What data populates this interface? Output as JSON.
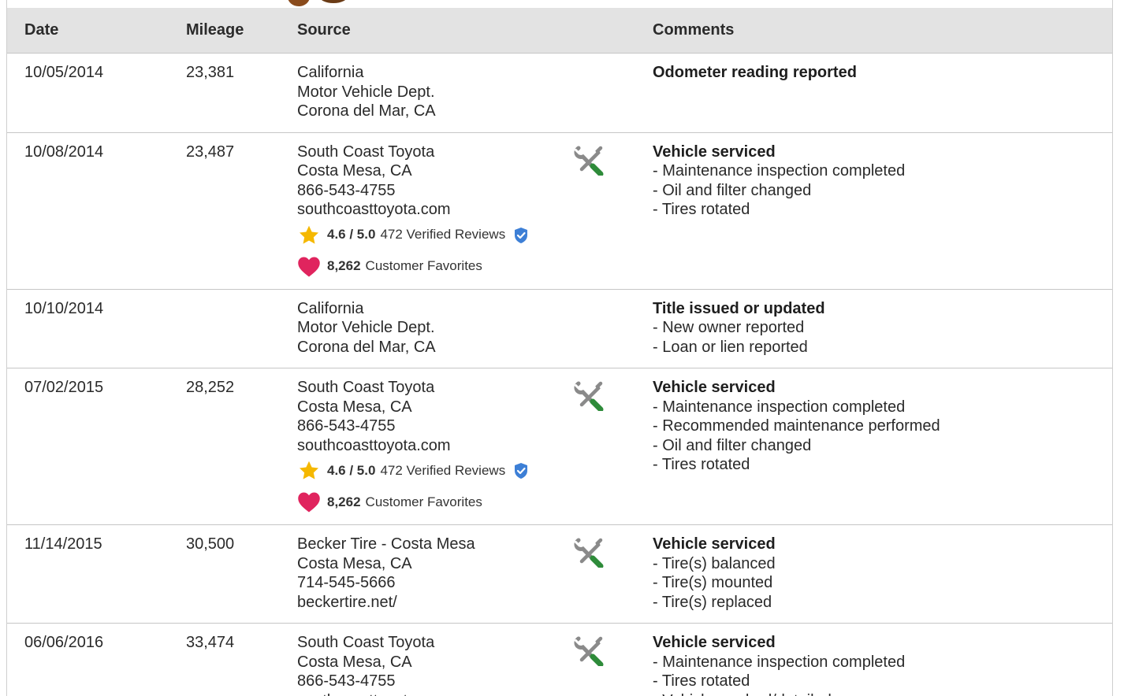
{
  "table": {
    "headers": {
      "date": "Date",
      "mileage": "Mileage",
      "source": "Source",
      "comments": "Comments"
    },
    "rows": [
      {
        "date": "10/05/2014",
        "mileage": "23,381",
        "source": [
          "California",
          "Motor Vehicle Dept.",
          "Corona del Mar, CA"
        ],
        "service_icon": false,
        "comment_title": "Odometer reading reported",
        "comment_items": []
      },
      {
        "date": "10/08/2014",
        "mileage": "23,487",
        "source": [
          "South Coast Toyota",
          "Costa Mesa, CA",
          "866-543-4755",
          "southcoasttoyota.com"
        ],
        "rating": {
          "score": "4.6 / 5.0",
          "reviews": "472 Verified Reviews"
        },
        "favorites": {
          "count": "8,262",
          "label": "Customer Favorites"
        },
        "service_icon": true,
        "comment_title": "Vehicle serviced",
        "comment_items": [
          "- Maintenance inspection completed",
          "- Oil and filter changed",
          "- Tires rotated"
        ]
      },
      {
        "date": "10/10/2014",
        "mileage": "",
        "source": [
          "California",
          "Motor Vehicle Dept.",
          "Corona del Mar, CA"
        ],
        "service_icon": false,
        "comment_title": "Title issued or updated",
        "comment_items": [
          "- New owner reported",
          "- Loan or lien reported"
        ]
      },
      {
        "date": "07/02/2015",
        "mileage": "28,252",
        "source": [
          "South Coast Toyota",
          "Costa Mesa, CA",
          "866-543-4755",
          "southcoasttoyota.com"
        ],
        "rating": {
          "score": "4.6 / 5.0",
          "reviews": "472 Verified Reviews"
        },
        "favorites": {
          "count": "8,262",
          "label": "Customer Favorites"
        },
        "service_icon": true,
        "comment_title": "Vehicle serviced",
        "comment_items": [
          "- Maintenance inspection completed",
          "- Recommended maintenance performed",
          "- Oil and filter changed",
          "- Tires rotated"
        ]
      },
      {
        "date": "11/14/2015",
        "mileage": "30,500",
        "source": [
          "Becker Tire - Costa Mesa",
          "Costa Mesa, CA",
          "714-545-5666",
          "beckertire.net/"
        ],
        "service_icon": true,
        "comment_title": "Vehicle serviced",
        "comment_items": [
          "- Tire(s) balanced",
          "- Tire(s) mounted",
          "- Tire(s) replaced"
        ]
      },
      {
        "date": "06/06/2016",
        "mileage": "33,474",
        "source": [
          "South Coast Toyota",
          "Costa Mesa, CA",
          "866-543-4755",
          "southcoasttoyota.com"
        ],
        "service_icon": true,
        "comment_title": "Vehicle serviced",
        "comment_items": [
          "- Maintenance inspection completed",
          "- Tires rotated",
          "- Vehicle washed/detailed"
        ]
      }
    ]
  },
  "colors": {
    "header_bg": "#e3e3e3",
    "star": "#f5b800",
    "heart": "#e0245e",
    "badge": "#3d7fd6",
    "wrench_gray": "#8a8a8a",
    "wrench_green": "#2e8b3a"
  },
  "icons": {
    "service": "wrench-screwdriver-icon",
    "rating": "star-icon",
    "verified": "verified-badge-icon",
    "favorites": "heart-icon"
  }
}
